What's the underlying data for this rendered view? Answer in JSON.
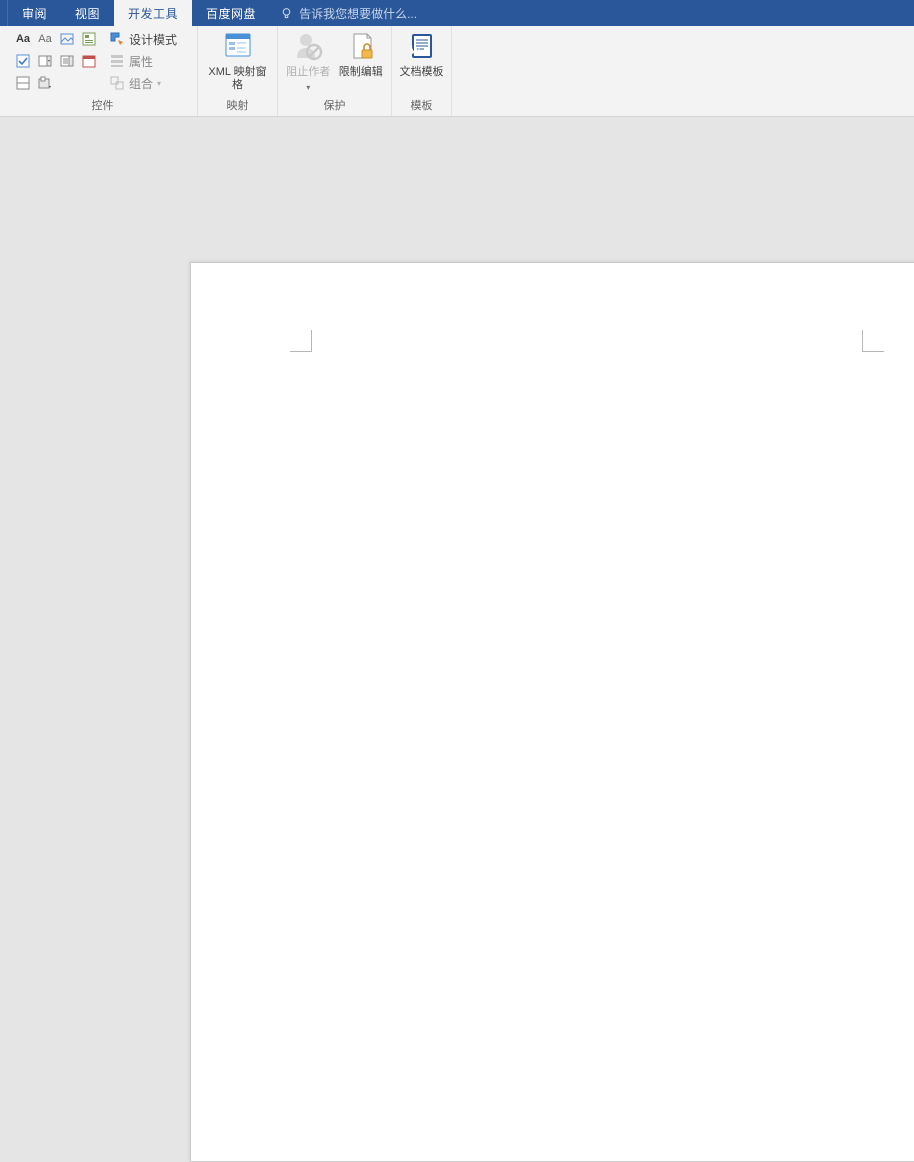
{
  "tabs": {
    "review": "审阅",
    "view": "视图",
    "dev": "开发工具",
    "baidu": "百度网盘"
  },
  "tellme": "告诉我您想要做什么...",
  "ribbon": {
    "controls": {
      "label": "控件",
      "design_mode": "设计模式",
      "properties": "属性",
      "group": "组合"
    },
    "mapping": {
      "label": "映射",
      "big": "XML 映射窗格"
    },
    "protect": {
      "label": "保护",
      "block": "阻止作者",
      "restrict": "限制编辑"
    },
    "template": {
      "label": "模板",
      "big": "文档模板"
    }
  }
}
